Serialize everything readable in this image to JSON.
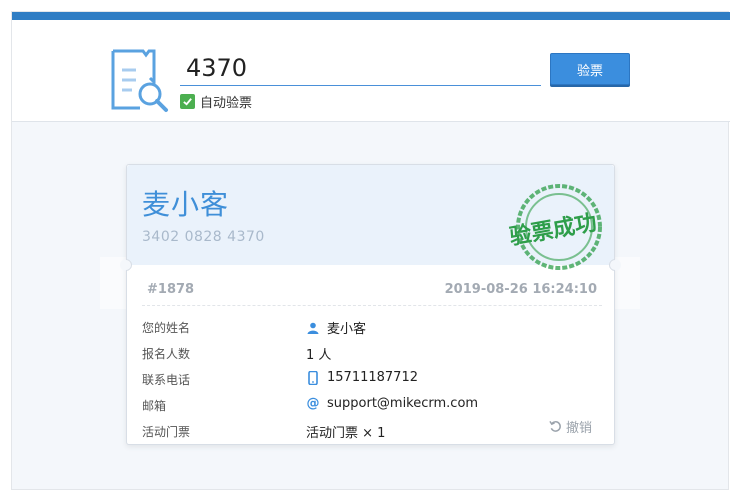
{
  "header": {
    "code_value": "4370",
    "verify_label": "验票",
    "auto_verify_label": "自动验票",
    "auto_verify_checked": true
  },
  "ticket": {
    "name": "麦小客",
    "code": "3402 0828 4370",
    "stamp_text": "验票成功",
    "serial": "#1878",
    "datetime": "2019-08-26 16:24:10",
    "fields": [
      {
        "label": "您的姓名",
        "value": "麦小客",
        "icon": "person-icon"
      },
      {
        "label": "报名人数",
        "value": "1 人",
        "icon": ""
      },
      {
        "label": "联系电话",
        "value": "15711187712",
        "icon": "phone-icon"
      },
      {
        "label": "邮箱",
        "value": "support@mikecrm.com",
        "icon": "at-icon"
      },
      {
        "label": "活动门票",
        "value": "活动门票 × 1",
        "icon": ""
      }
    ],
    "revoke_label": "撤销"
  },
  "colors": {
    "accent": "#2f7dc4",
    "button": "#3b8ede",
    "stamp": "#2e9e4a",
    "check": "#4caf50"
  }
}
